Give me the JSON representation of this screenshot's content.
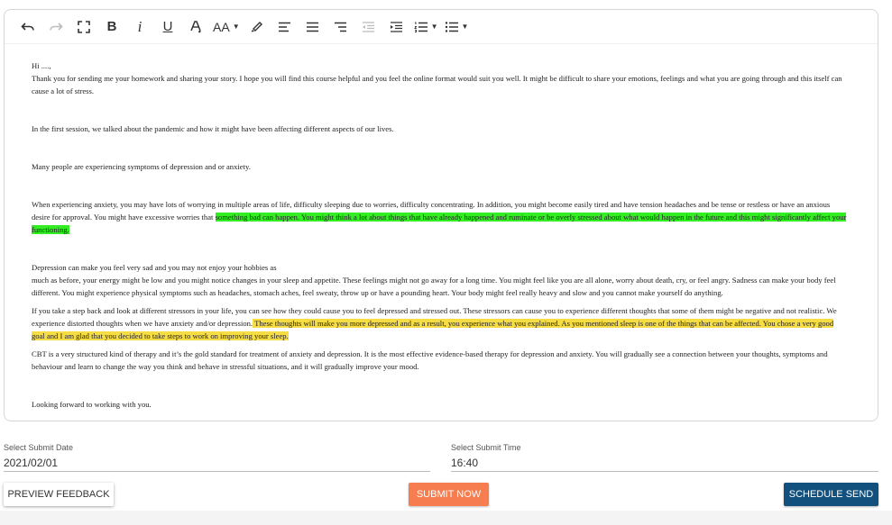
{
  "toolbar": {
    "buttons": [
      {
        "name": "undo-icon"
      },
      {
        "name": "redo-icon"
      },
      {
        "name": "fullscreen-icon"
      },
      {
        "name": "bold-button",
        "label": "B"
      },
      {
        "name": "italic-button",
        "label": "i"
      },
      {
        "name": "underline-button",
        "label": "U"
      },
      {
        "name": "font-color-icon"
      },
      {
        "name": "font-size-button",
        "label": "AA"
      },
      {
        "name": "highlight-icon"
      },
      {
        "name": "align-left-icon"
      },
      {
        "name": "align-center-icon"
      },
      {
        "name": "align-right-icon"
      },
      {
        "name": "outdent-icon"
      },
      {
        "name": "indent-icon"
      },
      {
        "name": "ordered-list-icon"
      },
      {
        "name": "bullet-list-icon"
      }
    ]
  },
  "content": {
    "greeting": "Hi ....,",
    "p1": "Thank you for sending me your homework and sharing your story. I hope you will find this course helpful and you feel the online format would suit you well.  It might be difficult to share your emotions, feelings and what you are going through and this itself can cause a lot of stress.",
    "p2": "In the first session, we talked about the pandemic and how it might have been affecting different aspects of our lives.",
    "p3": "Many people are experiencing symptoms of depression and or anxiety.",
    "p4_plain": "When experiencing anxiety, you may have lots of worrying in multiple areas of life, difficulty sleeping due to worries, difficulty concentrating. In addition, you might become easily tired and have tension headaches and be tense or restless or have an anxious desire for approval. You might have excessive worries that ",
    "p4_highlight": "something bad can happen. You might think a lot about things that have already happened and ruminate or be overly stressed about what would happen in the future and this might significantly affect your functioning.",
    "p5_line1": "Depression can make you feel very sad and you may not enjoy your hobbies as",
    "p5_line2": "much as before, your energy might be low and you might notice changes in your sleep and appetite. These feelings might not go away for a long time. You might feel like you are all alone, worry about death, cry, or feel angry. Sadness can make your body feel different. You might experience physical symptoms such as headaches, stomach aches, feel sweaty, throw up or have a pounding heart. Your body might feel really heavy and slow and you cannot make yourself do anything.",
    "p6_plain": "If you take a step back and look at different stressors in your life, you can see how they could cause you to feel depressed and stressed out. These stressors can cause you to experience different thoughts that some of them might be negative and not realistic. We experience distorted thoughts when we have anxiety and/or depression.",
    "p6_highlight": " These thoughts will make you more depressed and as a result, you experience what you explained. As you mentioned sleep is one of the things that can be affected. You chose a very good goal and I am glad that you decided to take steps to work on improving your sleep.",
    "p7": "CBT is a very structured kind of therapy and it’s the gold standard for treatment of anxiety and depression. It is the most effective evidence-based therapy for depression and anxiety. You will gradually see a connection between your thoughts, symptoms and behaviour and learn to change the way you think and behave in stressful situations, and it will gradually improve your mood.",
    "closing": "Looking forward to working with you."
  },
  "highlight_colors": {
    "green": "#33ee22",
    "yellow": "#f7dd44"
  },
  "submit_date": {
    "label": "Select Submit Date",
    "value": "2021/02/01"
  },
  "submit_time": {
    "label": "Select Submit Time",
    "value": "16:40"
  },
  "actions": {
    "preview": "PREVIEW FEEDBACK",
    "submit": "SUBMIT NOW",
    "schedule": "SCHEDULE SEND"
  },
  "colors": {
    "submit": "#f57d4f",
    "schedule": "#12507d"
  }
}
